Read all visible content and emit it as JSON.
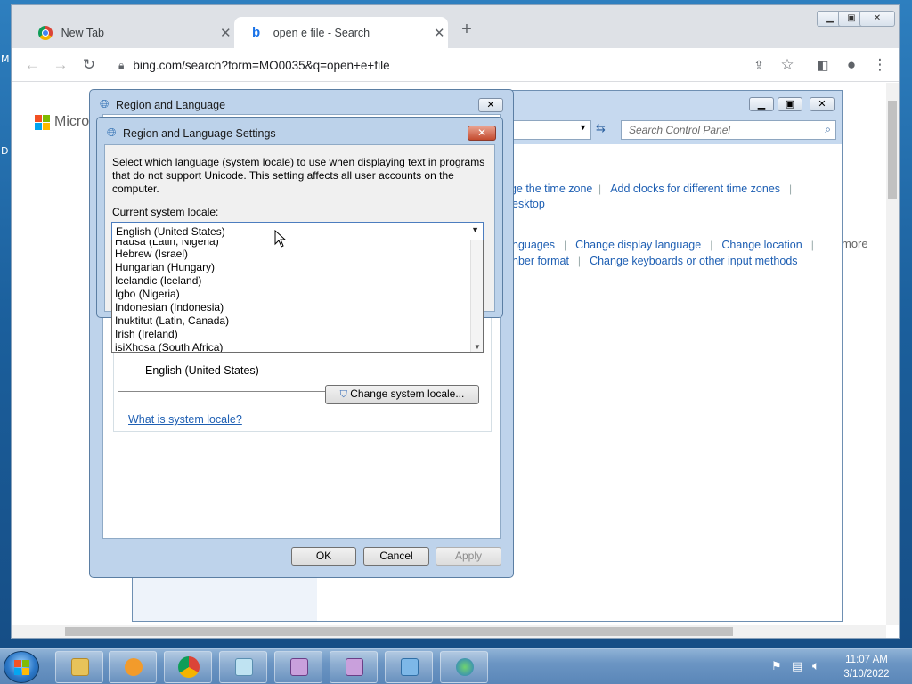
{
  "desktop": {
    "edge_glyph_top": "M",
    "edge_glyph_mid": "D"
  },
  "browser": {
    "tabs": [
      {
        "title": "New Tab",
        "icon": "chrome-icon",
        "active": false
      },
      {
        "title": "open e file - Search",
        "icon": "bing-icon",
        "active": true
      }
    ],
    "new_tab_symbol": "+",
    "close_symbol": "✕",
    "address": "bing.com/search?form=MO0035&q=open+e+file",
    "page_brand_partial": "Micros"
  },
  "control_panel": {
    "search_placeholder": "Search Control Panel",
    "links_row1": [
      "nge the time zone",
      "Add clocks for different time zones"
    ],
    "links_row1b": "esktop",
    "links_row2": [
      "nguages",
      "Change display language",
      "Change location"
    ],
    "links_row3": [
      "nber format",
      "Change keyboards or other input methods"
    ],
    "more_text": "more"
  },
  "region_language": {
    "title": "Region and Language",
    "current_language_label": "English (United States)",
    "change_locale_button": "Change system locale...",
    "what_is_link": "What is system locale?",
    "ok": "OK",
    "cancel": "Cancel",
    "apply": "Apply"
  },
  "locale_settings": {
    "title": "Region and Language Settings",
    "description": "Select which language (system locale) to use when displaying text in programs that do not support Unicode. This setting affects all user accounts on the computer.",
    "current_label": "Current system locale:",
    "selected": "English (United States)",
    "options": [
      "Hausa (Latin, Nigeria)",
      "Hebrew (Israel)",
      "Hungarian (Hungary)",
      "Icelandic (Iceland)",
      "Igbo (Nigeria)",
      "Indonesian (Indonesia)",
      "Inuktitut (Latin, Canada)",
      "Irish (Ireland)",
      "isiXhosa (South Africa)"
    ]
  },
  "taskbar": {
    "time": "11:07 AM",
    "date": "3/10/2022",
    "pinned": [
      "explorer-icon",
      "media-player-icon",
      "chrome-icon",
      "notepad-icon",
      "character-icon",
      "character-icon",
      "control-panel-icon",
      "globe-clock-icon"
    ]
  }
}
